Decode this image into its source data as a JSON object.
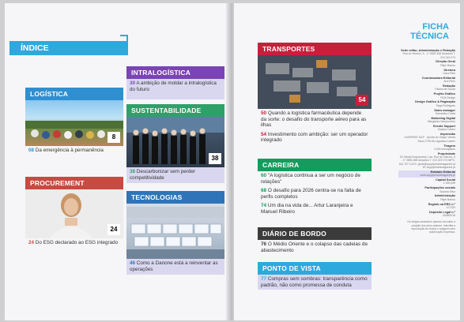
{
  "left_page": {
    "indice": "ÍNDICE",
    "logistica": {
      "title": "LOGÍSTICA",
      "page_badge": "8",
      "entries": [
        {
          "num": "08",
          "text": "Da emergência à permanência"
        }
      ]
    },
    "intralogistica": {
      "title": "INTRALOGÍSTICA",
      "entries": [
        {
          "num": "30",
          "text": "A ambição de moldar a intralogística do futuro"
        }
      ]
    },
    "sustentabilidade": {
      "title": "SUSTENTABILIDADE",
      "page_badge": "38",
      "entries": [
        {
          "num": "38",
          "text": "Descarbonizar sem perder competitividade"
        }
      ]
    },
    "procurement": {
      "title": "PROCUREMENT",
      "page_badge": "24",
      "entries": [
        {
          "num": "24",
          "text": "Do ESG declarado ao ESG integrado"
        }
      ]
    },
    "tecnologias": {
      "title": "TECNOLOGIAS",
      "entries": [
        {
          "num": "46",
          "text": "Como a Danone está a reinventar as operações"
        }
      ]
    }
  },
  "right_page": {
    "transportes": {
      "title": "TRANSPORTES",
      "page_badge": "54",
      "entries": [
        {
          "num": "50",
          "text": "Quando a logística farmacêutica depende da sorte: o desafio do transporte aéreo para as ilhas"
        },
        {
          "num": "54",
          "text": "Investimento com ambição: ser um operador integrado"
        }
      ]
    },
    "carreira": {
      "title": "CARREIRA",
      "entries": [
        {
          "num": "60",
          "text": "\"A logística continua a ser um negócio de relações\""
        },
        {
          "num": "68",
          "text": "O desafio para 2026 centra-se na falta de perfis completos"
        },
        {
          "num": "74",
          "text": "Um dia na vida de... Artur Laranjeira e Manuel Ribeiro"
        }
      ]
    },
    "diario": {
      "title": "DIÁRIO DE BORDO",
      "entries": [
        {
          "num": "76",
          "text": "O Médio Oriente e o colapso das cadeias de abastecimento"
        }
      ]
    },
    "ponto": {
      "title": "PONTO DE VISTA",
      "entries": [
        {
          "num": "77",
          "text": "Compras sem sombras: transparência como padrão, não como promessa de conduta"
        }
      ]
    },
    "ficha": {
      "title_line1": "FICHA",
      "title_line2": "TÉCNICA",
      "items": [
        {
          "t": "Sede editor, Administração e Redação",
          "v": "Rua do Vitorino, 5 - 1º 2650-368 Amadora T. 210 419 074"
        },
        {
          "t": "Direção Geral",
          "v": "Filipe Barros"
        },
        {
          "t": "Diretora",
          "v": "Clara Reis"
        },
        {
          "t": "Coordenadora Editorial",
          "v": "Ana Pires"
        },
        {
          "t": "Redação",
          "v": "Fátima de Sousa"
        },
        {
          "t": "Projeto Gráfico",
          "v": "FKM Design"
        },
        {
          "t": "Design Gráfico & Paginação",
          "v": "Tiago Rodrigues"
        },
        {
          "t": "Sales manager",
          "v": "Samantha Costa"
        },
        {
          "t": "Marketing Digital",
          "v": "Margarida Vasconcelos"
        },
        {
          "t": "Events Support",
          "v": "Susana Castro"
        },
        {
          "t": "Impressão",
          "v": "VIVAPRINT MLP - Quinta do Grajal, Venda Seca 2739-511 Agualva-Cacém"
        },
        {
          "t": "Tiragem",
          "v": "3.000 exemplares"
        },
        {
          "t": "Propriedade",
          "v": "SC Media Empresarial, Lda. Rua do Vitorino, 5 - 1º 2650-368 Amadora T. 210 419 074 NIPC: 514 707 143 E: geral@supplychainmagazine.pt W: supplychainmagazine.pt"
        },
        {
          "t": "Estatuto Editorial",
          "v": "www.supplychainmagazine.pt"
        },
        {
          "t": "Capital Social",
          "v": "1.000,00€"
        },
        {
          "t": "Participações sociais",
          "v": "Susana Silva"
        },
        {
          "t": "Administração",
          "v": "Filipe Barros"
        },
        {
          "t": "Registo na ERC n.º",
          "v": "127325"
        },
        {
          "t": "Depósito Legal n.º",
          "v": "433800/18"
        }
      ],
      "footer": "Os artigos assinados apenas vinculam a posição dos seus autores. Interdita a reprodução de textos e imagens sem autorização expressa."
    }
  },
  "colors": {
    "accent": "#2ea9dd",
    "logistica": "#2f8fd0",
    "intralogistica": "#7a44b4",
    "sustentabilidade": "#2ea06a",
    "procurement": "#c64b42",
    "tecnologias": "#2f74b8",
    "transportes": "#c6203b",
    "carreira": "#159b5d",
    "diario": "#3b3b3b",
    "ponto": "#2ea9dd"
  }
}
